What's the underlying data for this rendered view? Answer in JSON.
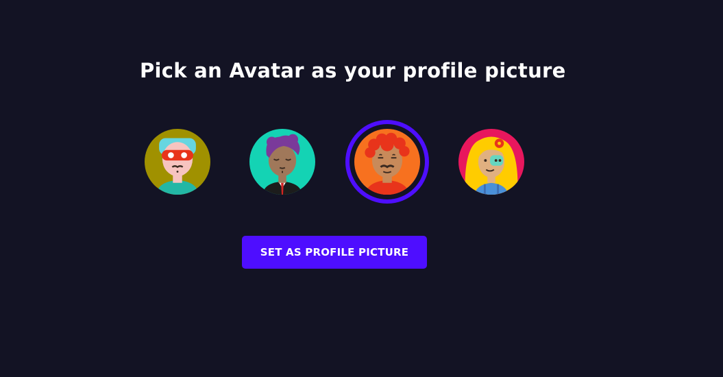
{
  "page": {
    "title": "Pick an Avatar as your profile picture",
    "button_label": "SET AS PROFILE PICTURE"
  },
  "avatars": [
    {
      "icon": "masked-man-avatar-icon",
      "selected": false
    },
    {
      "icon": "purple-hair-man-avatar-icon",
      "selected": false
    },
    {
      "icon": "curly-red-hair-man-avatar-icon",
      "selected": true
    },
    {
      "icon": "blonde-woman-avatar-icon",
      "selected": false
    }
  ],
  "colors": {
    "background": "#131324",
    "accent": "#4e0eff",
    "text": "#ffffff"
  }
}
